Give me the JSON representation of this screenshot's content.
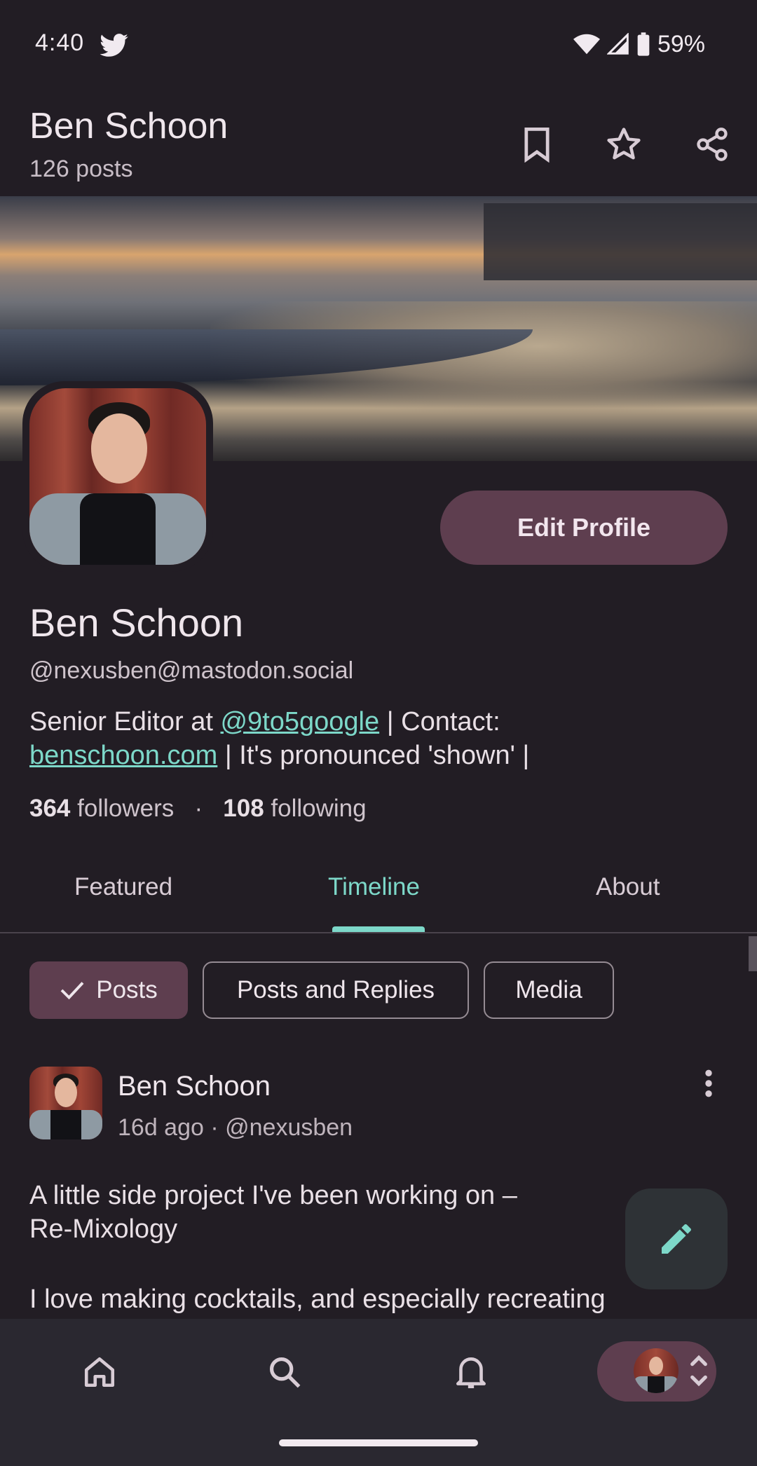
{
  "status_bar": {
    "time": "4:40",
    "battery": "59%"
  },
  "header": {
    "title": "Ben Schoon",
    "post_count": "126 posts"
  },
  "profile": {
    "edit_button": "Edit Profile",
    "display_name": "Ben Schoon",
    "handle": "@nexusben@mastodon.social",
    "bio": {
      "prefix": "Senior Editor at ",
      "link1": "@9to5google",
      "middle": " | Contact:",
      "link2": "benschoon.com",
      "suffix": " | It's pronounced 'shown' |"
    },
    "followers_count": "364",
    "followers_label": "followers",
    "separator": "·",
    "following_count": "108",
    "following_label": "following"
  },
  "tabs": {
    "featured": "Featured",
    "timeline": "Timeline",
    "about": "About"
  },
  "filters": {
    "posts": "Posts",
    "posts_and_replies": "Posts and Replies",
    "media": "Media"
  },
  "post": {
    "author": "Ben Schoon",
    "meta": "16d ago · @nexusben",
    "text_line1": "A little side project I've been working on –",
    "text_line2": "Re-Mixology",
    "text_line3": "I love making cocktails, and especially recreating"
  },
  "colors": {
    "accent_teal": "#7dd8c9",
    "accent_mauve": "#5e3e4f",
    "background": "#221d24"
  },
  "icons": {
    "header": [
      "bookmark-icon",
      "star-icon",
      "share-icon"
    ],
    "nav": [
      "home-icon",
      "search-icon",
      "bell-icon",
      "account-switcher"
    ],
    "fab": "pencil-icon"
  }
}
